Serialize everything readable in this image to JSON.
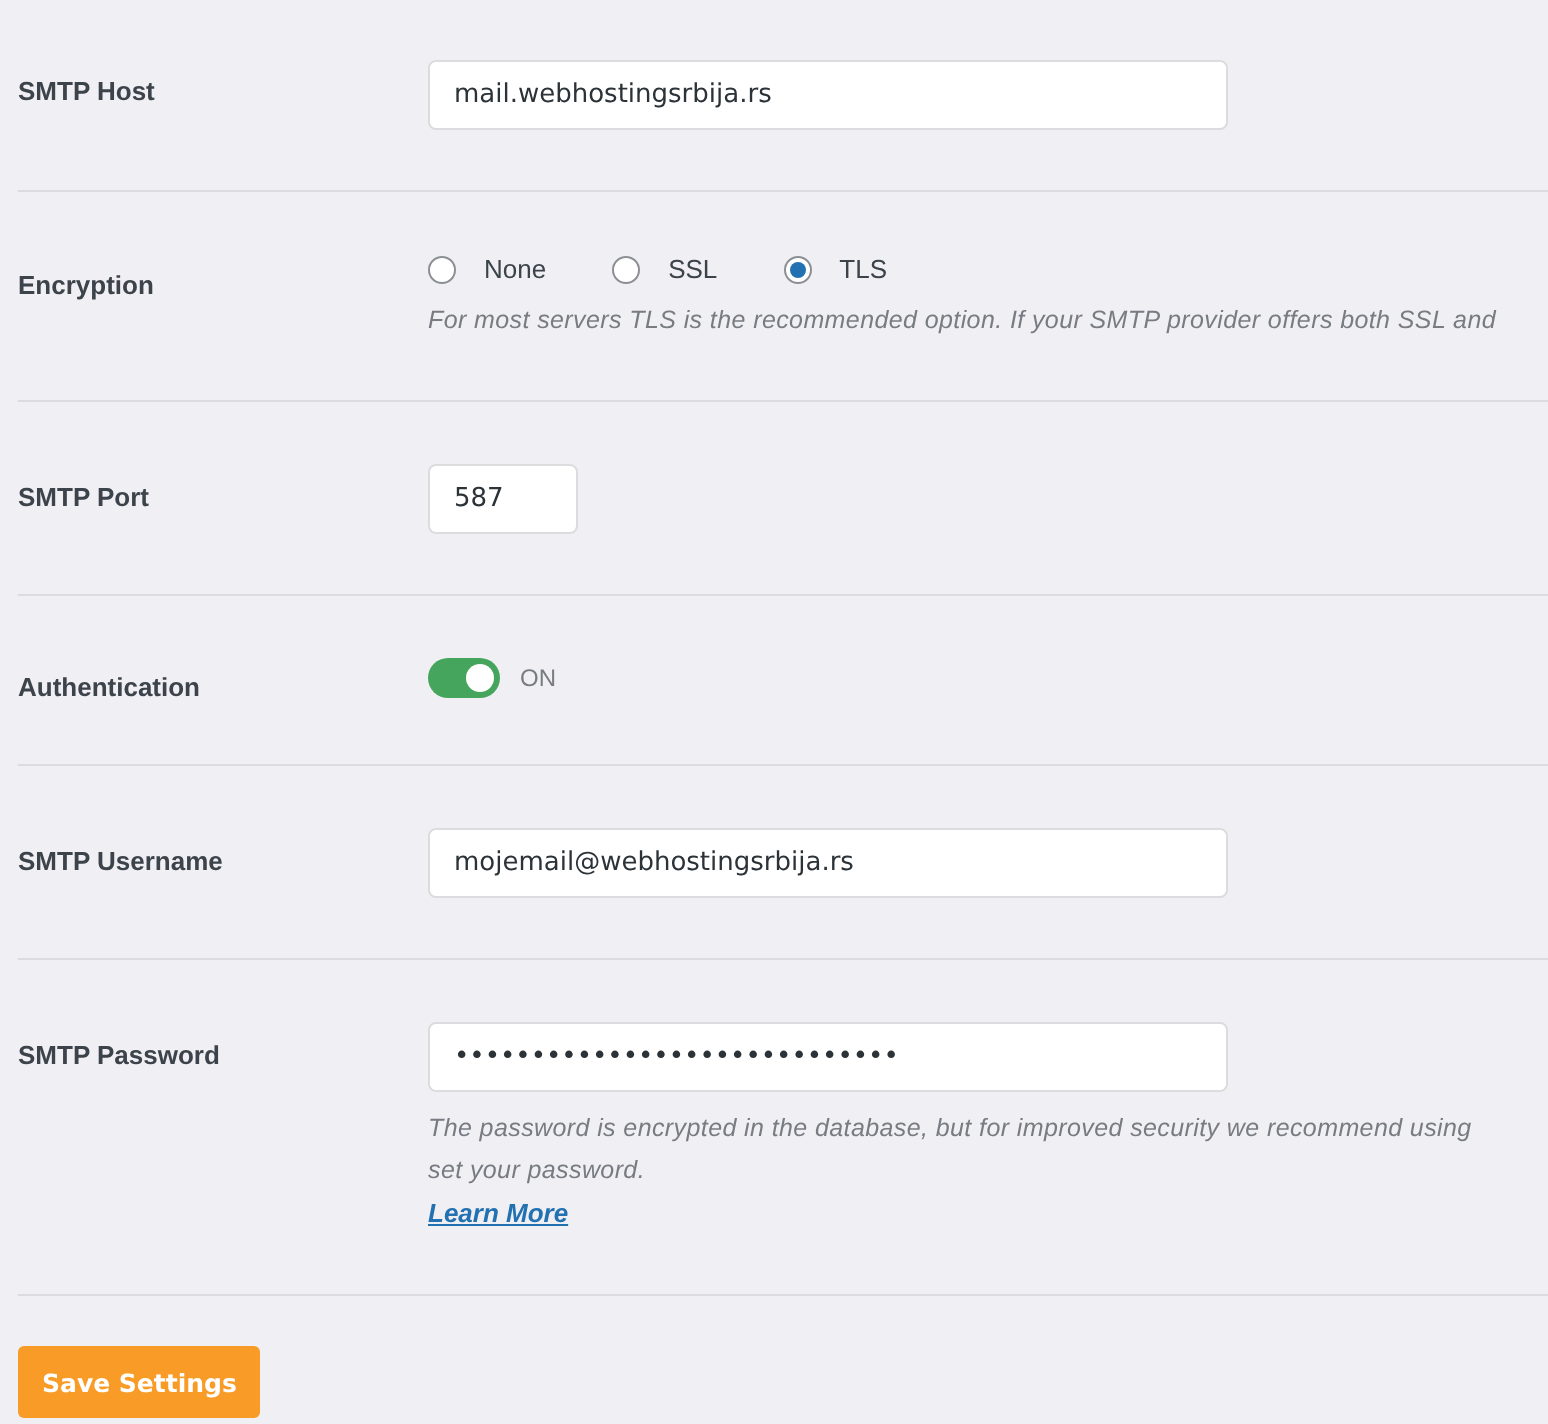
{
  "rows": [
    {
      "kind": "text",
      "label": "SMTP Host",
      "value": "mail.webhostingsrbija.rs"
    },
    {
      "kind": "radio",
      "label": "Encryption",
      "options": [
        {
          "label": "None",
          "selected": false
        },
        {
          "label": "SSL",
          "selected": false
        },
        {
          "label": "TLS",
          "selected": true
        }
      ],
      "help": [
        "For most servers TLS is the recommended option. If your SMTP provider offers both SSL and"
      ]
    },
    {
      "kind": "port",
      "label": "SMTP Port",
      "value": "587"
    },
    {
      "kind": "toggle",
      "label": "Authentication",
      "on": true,
      "state_label": "ON"
    },
    {
      "kind": "text",
      "label": "SMTP Username",
      "value": "mojemail@webhostingsrbija.rs"
    },
    {
      "kind": "text",
      "label": "SMTP Password",
      "value": "•••••••••••••••••••••••••••••",
      "help": [
        "The password is encrypted in the database, but for improved security we recommend using",
        "set your password."
      ],
      "link": "Learn More"
    }
  ],
  "save_button": "Save Settings"
}
